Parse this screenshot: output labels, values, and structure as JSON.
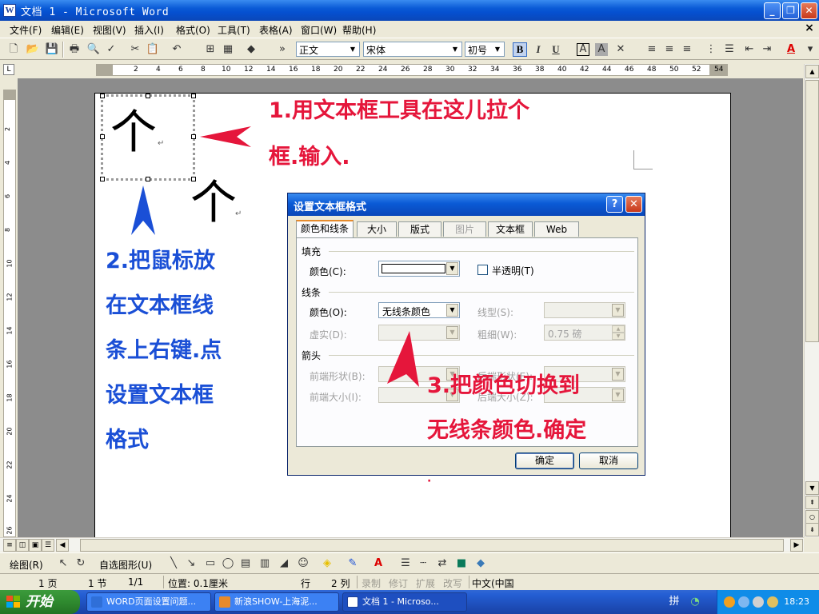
{
  "window": {
    "title": "文档 1 - Microsoft Word",
    "app_icon": "W",
    "minimize": "_",
    "restore": "❐",
    "close": "✕"
  },
  "menu": {
    "items": [
      "文件(F)",
      "编辑(E)",
      "视图(V)",
      "插入(I)",
      "格式(O)",
      "工具(T)",
      "表格(A)",
      "窗口(W)",
      "帮助(H)"
    ],
    "doc_close": "×"
  },
  "toolbar": {
    "style_value": "正文",
    "font_value": "宋体",
    "size_value": "初号",
    "bold": "B",
    "italic": "I",
    "underline": "U",
    "border_char": "A",
    "shade_char": "A",
    "font_color_char": "A",
    "overflow": "»"
  },
  "ruler": {
    "corner": "L",
    "h_ticks": [
      "2",
      "4",
      "6",
      "8",
      "10",
      "12",
      "14",
      "16",
      "18",
      "20",
      "22",
      "24",
      "26",
      "28",
      "30",
      "32",
      "34",
      "36",
      "38",
      "40",
      "42",
      "44",
      "46",
      "48",
      "50",
      "52",
      "54"
    ],
    "v_ticks": [
      "2",
      "4",
      "6",
      "8",
      "10",
      "12",
      "14",
      "16",
      "18",
      "20",
      "22",
      "24",
      "26"
    ]
  },
  "document": {
    "textbox_char": "个",
    "inline_char": "个",
    "para_mark": "↵",
    "stray_mark": "·"
  },
  "annotations": {
    "step1_line1": "1.用文本框工具在这儿拉个",
    "step1_line2": "框.输入.",
    "step2_lines": [
      "2.把鼠标放",
      "在文本框线",
      "条上右键.点",
      "设置文本框",
      "格式"
    ],
    "step3_line1": "3.把颜色切换到",
    "step3_line2": "无线条颜色.确定",
    "colors": {
      "red": "#e5163b",
      "blue": "#1a4fd6"
    }
  },
  "dialog": {
    "title": "设置文本框格式",
    "help": "?",
    "close": "✕",
    "tabs": [
      {
        "label": "颜色和线条",
        "state": "active"
      },
      {
        "label": "大小",
        "state": "normal"
      },
      {
        "label": "版式",
        "state": "normal"
      },
      {
        "label": "图片",
        "state": "disabled"
      },
      {
        "label": "文本框",
        "state": "normal"
      },
      {
        "label": "Web",
        "state": "normal"
      }
    ],
    "fill": {
      "group": "填充",
      "color_label": "颜色(C):",
      "transparent_label": "半透明(T)"
    },
    "line": {
      "group": "线条",
      "color_label": "颜色(O):",
      "color_value": "无线条颜色",
      "style_label": "线型(S):",
      "dash_label": "虚实(D):",
      "weight_label": "粗细(W):",
      "weight_value": "0.75 磅"
    },
    "arrows": {
      "group": "箭头",
      "begin_style_label": "前端形状(B):",
      "begin_size_label": "前端大小(I):",
      "end_style_label": "后端形状(E):",
      "end_size_label": "后端大小(Z):"
    },
    "ok": "确定",
    "cancel": "取消"
  },
  "drawbar": {
    "draw": "绘图(R)",
    "autoshapes": "自选图形(U)"
  },
  "status": {
    "page": "1 页",
    "section": "1 节",
    "page_of": "1/1",
    "position": "位置: 0.1厘米",
    "line": "行",
    "column": "2 列",
    "rec": "录制",
    "trk": "修订",
    "ext": "扩展",
    "ovr": "改写",
    "language": "中文(中国"
  },
  "taskbar": {
    "start": "开始",
    "tasks": [
      {
        "label": "WORD页面设置问题...",
        "active": false,
        "icon_color": "#2f6fd8"
      },
      {
        "label": "新浪SHOW-上海泥...",
        "active": false,
        "icon_color": "#e88a2a"
      },
      {
        "label": "文档 1 - Microso...",
        "active": true,
        "icon_color": "#1b3f99"
      }
    ],
    "clock": "18:23"
  }
}
